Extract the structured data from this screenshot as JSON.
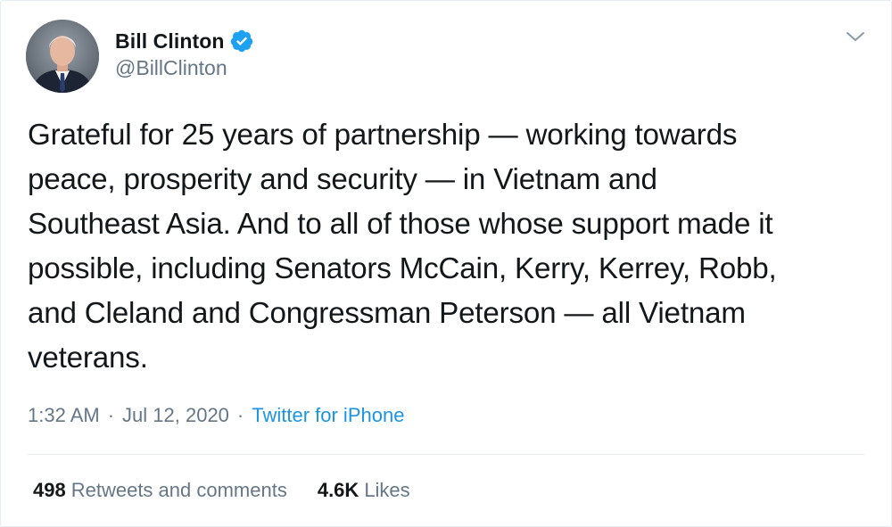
{
  "user": {
    "display_name": "Bill Clinton",
    "handle": "@BillClinton",
    "verified": true,
    "avatar": "profile-photo"
  },
  "tweet": {
    "text": "Grateful for 25 years of partnership — working towards\npeace, prosperity and security — in Vietnam and\nSoutheast Asia. And to all of those whose support made it\npossible, including Senators McCain, Kerry, Kerrey, Robb,\nand Cleland and Congressman Peterson — all Vietnam\nveterans.",
    "time": "1:32 AM",
    "date": "Jul 12, 2020",
    "source": "Twitter for iPhone",
    "separator": "·"
  },
  "stats": {
    "retweets_count": "498",
    "retweets_label": "Retweets and comments",
    "likes_count": "4.6K",
    "likes_label": "Likes"
  },
  "colors": {
    "text": "#14171a",
    "secondary": "#657786",
    "link": "#1b95e0",
    "verified": "#1da1f2",
    "divider": "#e6ecf0"
  },
  "icons": {
    "verified": "verified-badge-icon",
    "menu": "chevron-down-icon"
  }
}
